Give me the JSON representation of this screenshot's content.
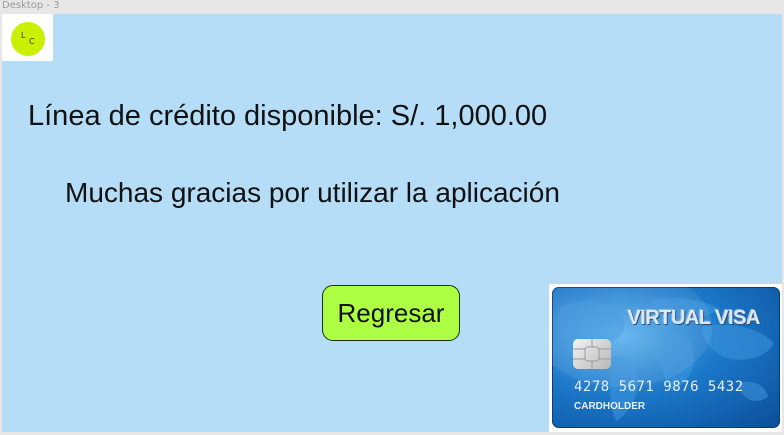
{
  "window": {
    "frame_label": "Desktop - 3"
  },
  "logo": {
    "letter_l": "L",
    "letter_c": "C"
  },
  "main": {
    "credit_line": "Línea de crédito disponible: S/. 1,000.00",
    "thanks": "Muchas gracias por utilizar la aplicación",
    "back_button_label": "Regresar"
  },
  "card": {
    "title": "VIRTUAL VISA",
    "number": "4278 5671 9876 5432",
    "holder": "CARDHOLDER"
  },
  "colors": {
    "artboard_background": "#b5ddf8",
    "button_background": "#adff44",
    "logo_circle": "#c9f000"
  }
}
